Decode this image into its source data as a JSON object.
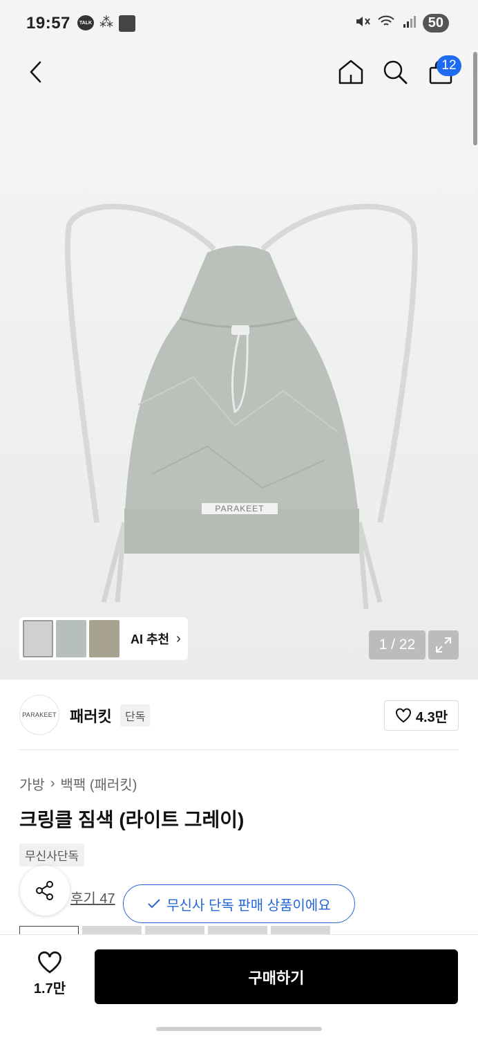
{
  "status_bar": {
    "time": "19:57",
    "talk_label": "TALK",
    "battery": "50"
  },
  "header": {
    "cart_count": "12"
  },
  "product_image": {
    "label_text": "PARAKEET"
  },
  "ai_recommend": {
    "label": "AI 추천"
  },
  "pager": {
    "current": "1",
    "total": "22",
    "text": "1 / 22"
  },
  "brand": {
    "logo_text": "PARAKEET",
    "name": "패러킷",
    "badge": "단독",
    "likes": "4.3만"
  },
  "breadcrumb": {
    "items": [
      "가방",
      "백팩 (패러킷)"
    ]
  },
  "product": {
    "title": "크링클 짐색 (라이트 그레이)",
    "tag": "무신사단독",
    "review_link": "후기 47",
    "toast": "무신사 단독 판매 상품이에요"
  },
  "bottom_bar": {
    "like_count": "1.7만",
    "buy_label": "구매하기"
  },
  "colors": {
    "accent_blue": "#1e6bf0",
    "buy_button": "#000000",
    "bag_color": "#b9c1ba"
  },
  "icons": [
    "back-icon",
    "home-icon",
    "search-icon",
    "cart-icon",
    "expand-icon",
    "heart-icon",
    "share-icon",
    "check-icon",
    "chevron-right-icon"
  ]
}
